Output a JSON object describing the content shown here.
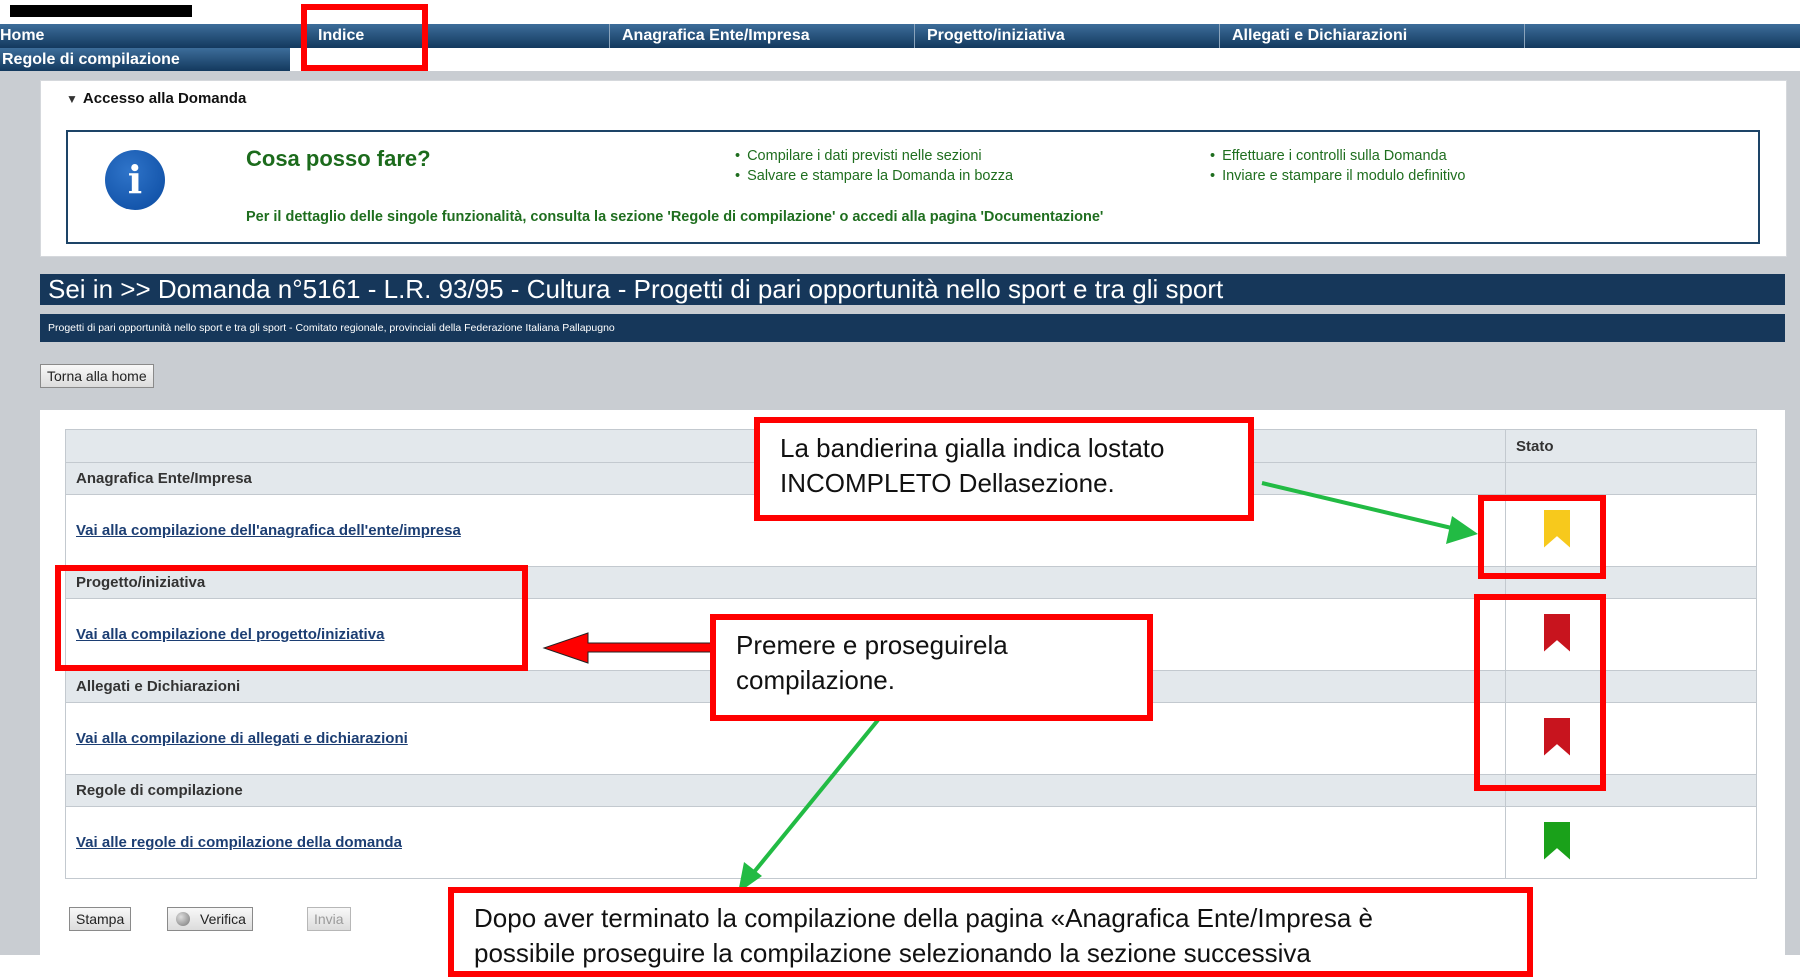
{
  "nav": {
    "items": [
      "Home",
      "Indice",
      "Anagrafica Ente/Impresa",
      "Progetto/iniziativa",
      "Allegati e Dichiarazioni"
    ],
    "second_row": "Regole di compilazione"
  },
  "access": {
    "section_title": "Accesso alla Domanda",
    "what_can_i_do": "Cosa posso fare?",
    "bullets_left": [
      "Compilare i dati previsti nelle sezioni",
      "Salvare e stampare la Domanda in bozza"
    ],
    "bullets_right": [
      "Effettuare i controlli sulla Domanda",
      "Inviare e stampare il modulo definitivo"
    ],
    "detail": "Per il dettaglio delle singole funzionalità, consulta la sezione 'Regole di compilazione' o accedi alla pagina 'Documentazione'"
  },
  "page": {
    "sei_in": "Sei in >> Domanda n°5161 - L.R. 93/95 - Cultura - Progetti di pari opportunità nello sport e tra gli sport",
    "subtitle": "Progetti di pari opportunità nello sport e tra gli sport - Comitato regionale, provinciali della Federazione Italiana Pallapugno",
    "home_button": "Torna alla home"
  },
  "table": {
    "stato_header": "Stato",
    "sections": [
      {
        "title": "Anagrafica Ente/Impresa",
        "link": "Vai alla compilazione dell'anagrafica dell'ente/impresa",
        "status_color": "#f7c91c"
      },
      {
        "title": "Progetto/iniziativa",
        "link": "Vai alla compilazione del progetto/iniziativa",
        "status_color": "#c8141e"
      },
      {
        "title": "Allegati e Dichiarazioni",
        "link": "Vai alla compilazione di allegati e dichiarazioni",
        "status_color": "#c8141e"
      },
      {
        "title": "Regole di compilazione",
        "link": "Vai alle regole di compilazione della domanda",
        "status_color": "#1aa11a"
      }
    ]
  },
  "buttons": {
    "stampa": "Stampa",
    "verifica": "Verifica",
    "invia": "Invia"
  },
  "annotations": {
    "yellow_flag_note_line1": "La bandierina gialla indica lostato",
    "yellow_flag_note_line2": "INCOMPLETO Dellasezione.",
    "press_note_line1": "Premere e proseguirela",
    "press_note_line2": "compilazione.",
    "after_note_line1": "Dopo aver terminato la compilazione della pagina «Anagrafica Ente/Impresa è",
    "after_note_line2": "possibile proseguire la compilazione selezionando la sezione successiva"
  }
}
